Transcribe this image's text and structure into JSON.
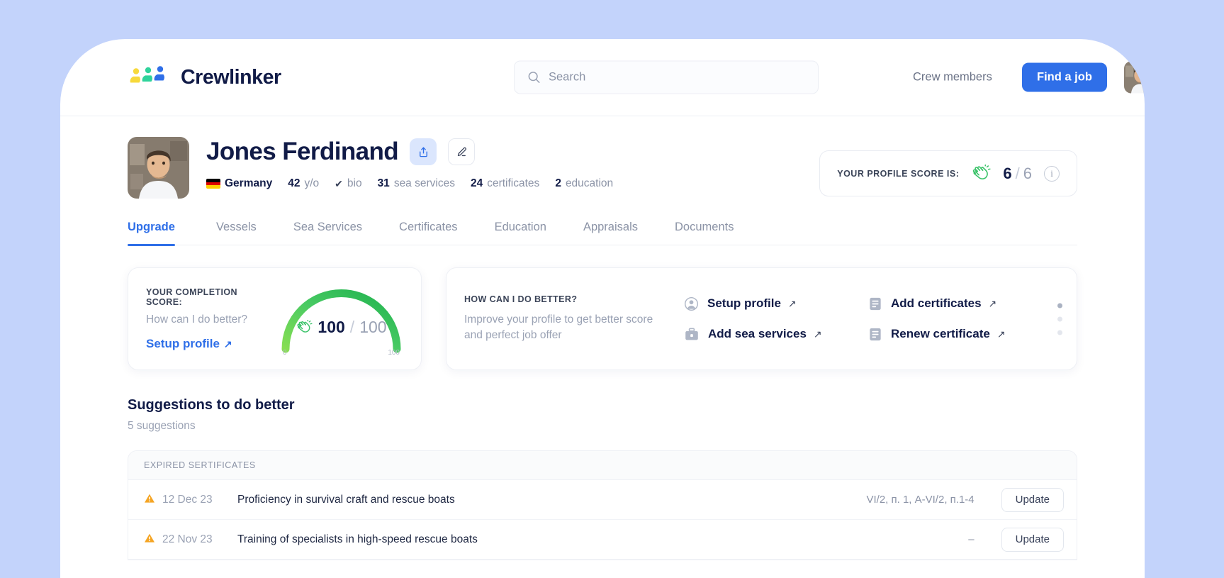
{
  "theme": {
    "page_bg": "#c3d3fb",
    "accent_blue": "#2f6fe8",
    "ink": "#111b47",
    "muted": "#8b93a6",
    "green": "#3cc36a",
    "warn_orange": "#f5a524"
  },
  "header": {
    "brand": "Crewlinker",
    "search": {
      "value": "",
      "placeholder": "Search"
    },
    "crew_members_label": "Crew members",
    "find_job_label": "Find a job",
    "avatar_status": "online"
  },
  "profile": {
    "name": "Jones Ferdinand",
    "meta": {
      "country": "Germany",
      "age": "42",
      "age_unit": "y/o",
      "bio": "bio",
      "sea_services_count": "31",
      "sea_services_label": "sea services",
      "certificates_count": "24",
      "certificates_label": "certificates",
      "education_count": "2",
      "education_label": "education"
    },
    "score_card": {
      "label": "YOUR PROFILE SCORE IS:",
      "value": "6",
      "separator": "/",
      "max": "6",
      "info": "i"
    }
  },
  "tabs": [
    {
      "label": "Upgrade",
      "active": true
    },
    {
      "label": "Vessels",
      "active": false
    },
    {
      "label": "Sea Services",
      "active": false
    },
    {
      "label": "Certificates",
      "active": false
    },
    {
      "label": "Education",
      "active": false
    },
    {
      "label": "Appraisals",
      "active": false
    },
    {
      "label": "Documents",
      "active": false
    }
  ],
  "completion_card": {
    "kicker": "YOUR COMPLETION SCORE:",
    "subtitle": "How can I do better?",
    "link_label": "Setup profile",
    "link_arrow": "↗",
    "gauge": {
      "value": "100",
      "separator": "/",
      "max": "100",
      "tick_min": "0",
      "tick_max": "100"
    }
  },
  "better_card": {
    "kicker": "HOW CAN I DO BETTER?",
    "subtitle": "Improve your profile to get better score and perfect job offer",
    "actions": [
      {
        "label": "Setup profile",
        "icon": "user-circle-icon",
        "arrow": "↗"
      },
      {
        "label": "Add certificates",
        "icon": "document-icon",
        "arrow": "↗"
      },
      {
        "label": "Add sea services",
        "icon": "briefcase-icon",
        "arrow": "↗"
      },
      {
        "label": "Renew certificate",
        "icon": "document-icon",
        "arrow": "↗"
      }
    ],
    "pagination_dots": 3,
    "active_dot": 0
  },
  "suggestions": {
    "title": "Suggestions to do better",
    "count_label": "5 suggestions",
    "group_header": "EXPIRED SERTIFICATES",
    "update_label": "Update",
    "rows": [
      {
        "date": "12 Dec 23",
        "title": "Proficiency in survival craft and rescue boats",
        "code": "VI/2, п. 1, A-VI/2, п.1-4",
        "action": "Update"
      },
      {
        "date": "22 Nov 23",
        "title": "Training of specialists in high-speed rescue boats",
        "code": "–",
        "action": "Update"
      }
    ]
  }
}
